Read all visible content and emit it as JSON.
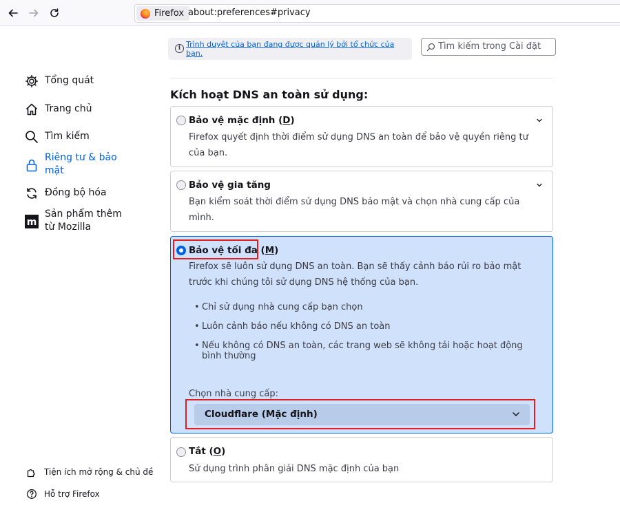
{
  "browser": {
    "back_icon": "arrow-left-icon",
    "forward_icon": "arrow-right-icon",
    "reload_icon": "reload-icon",
    "identity_label": "Firefox",
    "url": "about:preferences#privacy"
  },
  "notice": {
    "text": "Trình duyệt của bạn đang được quản lý bởi tổ chức của bạn."
  },
  "search": {
    "placeholder": "Tìm kiếm trong Cài đặt"
  },
  "sidebar": {
    "items": [
      {
        "label": "Tổng quát",
        "icon": "gear-icon"
      },
      {
        "label": "Trang chủ",
        "icon": "home-icon"
      },
      {
        "label": "Tìm kiếm",
        "icon": "search-icon"
      },
      {
        "label": "Riêng tư & bảo mật",
        "icon": "lock-icon",
        "active": true
      },
      {
        "label": "Đồng bộ hóa",
        "icon": "sync-icon"
      },
      {
        "label": "Sản phẩm thêm từ Mozilla",
        "icon": "mozilla-icon"
      }
    ],
    "footer": [
      {
        "label": "Tiện ích mở rộng & chủ đề",
        "icon": "puzzle-icon"
      },
      {
        "label": "Hỗ trợ Firefox",
        "icon": "help-icon"
      }
    ]
  },
  "dns": {
    "heading": "Kích hoạt DNS an toàn sử dụng:",
    "options": [
      {
        "title_pre": "Bảo vệ mặc định (",
        "title_key": "D",
        "title_post": ")",
        "description": "Firefox quyết định thời điểm sử dụng DNS an toàn để bảo vệ quyền riêng tư của bạn.",
        "selected": false
      },
      {
        "title_pre": "Bảo vệ gia tăng",
        "title_key": "",
        "title_post": "",
        "description": "Bạn kiểm soát thời điểm sử dụng DNS bảo mật và chọn nhà cung cấp của mình.",
        "selected": false
      },
      {
        "title_pre": "Bảo vệ tối đa (",
        "title_key": "M",
        "title_post": ")",
        "description": "Firefox sẽ luôn sử dụng DNS an toàn. Bạn sẽ thấy cảnh báo rủi ro bảo mật trước khi chúng tôi sử dụng DNS hệ thống của bạn.",
        "bullets": [
          "Chỉ sử dụng nhà cung cấp bạn chọn",
          "Luôn cảnh báo nếu không có DNS an toàn",
          "Nếu không có DNS an toàn, các trang web sẽ không tải hoặc hoạt động bình thường"
        ],
        "provider_label": "Chọn nhà cung cấp:",
        "provider_value": "Cloudflare (Mặc định)",
        "selected": true
      },
      {
        "title_pre": "Tắt (",
        "title_key": "O",
        "title_post": ")",
        "description": "Sử dụng trình phân giải DNS mặc định của bạn",
        "selected": false
      }
    ]
  },
  "colors": {
    "accent": "#0061e0",
    "selected_bg": "#cfe1fb",
    "highlight_red": "#e01e1e"
  }
}
